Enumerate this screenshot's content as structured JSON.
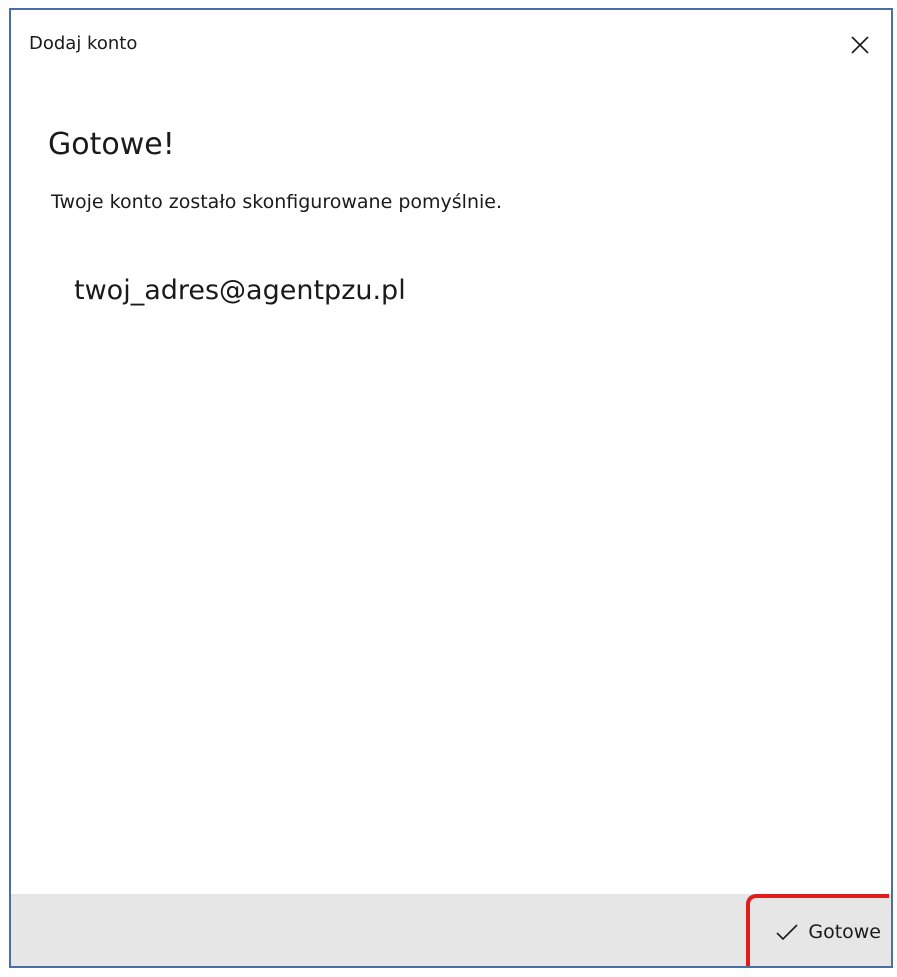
{
  "window": {
    "title": "Dodaj konto",
    "close_icon": "close-icon"
  },
  "content": {
    "heading": "Gotowe!",
    "description": "Twoje konto zostało skonfigurowane pomyślnie.",
    "email": "twoj_adres@agentpzu.pl"
  },
  "footer": {
    "done_label": "Gotowe",
    "done_icon": "checkmark-icon",
    "highlight_color": "#e21b1b"
  }
}
